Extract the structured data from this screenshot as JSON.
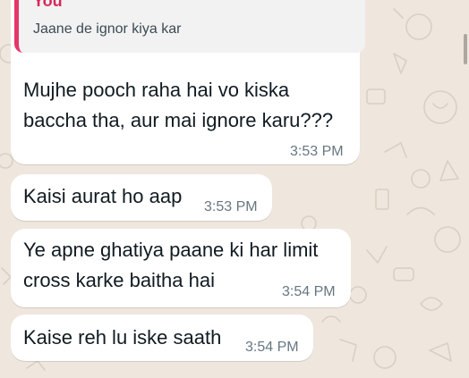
{
  "theme": {
    "wallpaper": "#efe7de",
    "bubble_bg": "#ffffff",
    "quote_bar": "#e5366a",
    "quote_author_color": "#d6285e",
    "time_color": "#667781"
  },
  "quoted_message": {
    "author": "You",
    "text": "Jaane de ignor kiya kar"
  },
  "messages": [
    {
      "text": "Mujhe pooch raha hai vo kiska\nbaccha tha, aur mai ignore karu???",
      "time": "3:53 PM",
      "direction": "incoming",
      "has_quote": true
    },
    {
      "text": "Kaisi aurat ho aap",
      "time": "3:53 PM",
      "direction": "incoming",
      "has_quote": false
    },
    {
      "text": "Ye apne ghatiya paane ki har limit\ncross karke baitha hai",
      "time": "3:54 PM",
      "direction": "incoming",
      "has_quote": false
    },
    {
      "text": "Kaise reh lu iske saath",
      "time": "3:54 PM",
      "direction": "incoming",
      "has_quote": false
    }
  ]
}
